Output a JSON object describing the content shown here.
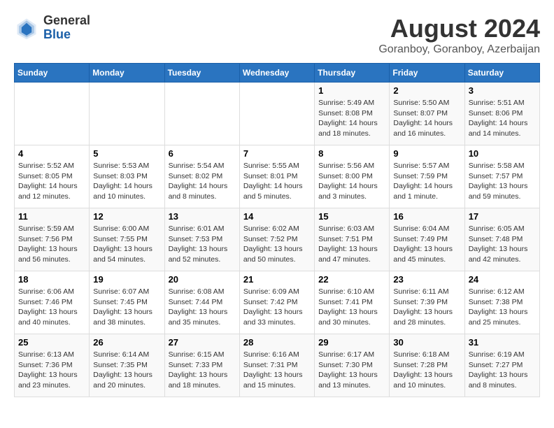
{
  "header": {
    "logo_general": "General",
    "logo_blue": "Blue",
    "month_year": "August 2024",
    "location": "Goranboy, Goranboy, Azerbaijan"
  },
  "weekdays": [
    "Sunday",
    "Monday",
    "Tuesday",
    "Wednesday",
    "Thursday",
    "Friday",
    "Saturday"
  ],
  "weeks": [
    [
      {
        "day": "",
        "info": ""
      },
      {
        "day": "",
        "info": ""
      },
      {
        "day": "",
        "info": ""
      },
      {
        "day": "",
        "info": ""
      },
      {
        "day": "1",
        "info": "Sunrise: 5:49 AM\nSunset: 8:08 PM\nDaylight: 14 hours\nand 18 minutes."
      },
      {
        "day": "2",
        "info": "Sunrise: 5:50 AM\nSunset: 8:07 PM\nDaylight: 14 hours\nand 16 minutes."
      },
      {
        "day": "3",
        "info": "Sunrise: 5:51 AM\nSunset: 8:06 PM\nDaylight: 14 hours\nand 14 minutes."
      }
    ],
    [
      {
        "day": "4",
        "info": "Sunrise: 5:52 AM\nSunset: 8:05 PM\nDaylight: 14 hours\nand 12 minutes."
      },
      {
        "day": "5",
        "info": "Sunrise: 5:53 AM\nSunset: 8:03 PM\nDaylight: 14 hours\nand 10 minutes."
      },
      {
        "day": "6",
        "info": "Sunrise: 5:54 AM\nSunset: 8:02 PM\nDaylight: 14 hours\nand 8 minutes."
      },
      {
        "day": "7",
        "info": "Sunrise: 5:55 AM\nSunset: 8:01 PM\nDaylight: 14 hours\nand 5 minutes."
      },
      {
        "day": "8",
        "info": "Sunrise: 5:56 AM\nSunset: 8:00 PM\nDaylight: 14 hours\nand 3 minutes."
      },
      {
        "day": "9",
        "info": "Sunrise: 5:57 AM\nSunset: 7:59 PM\nDaylight: 14 hours\nand 1 minute."
      },
      {
        "day": "10",
        "info": "Sunrise: 5:58 AM\nSunset: 7:57 PM\nDaylight: 13 hours\nand 59 minutes."
      }
    ],
    [
      {
        "day": "11",
        "info": "Sunrise: 5:59 AM\nSunset: 7:56 PM\nDaylight: 13 hours\nand 56 minutes."
      },
      {
        "day": "12",
        "info": "Sunrise: 6:00 AM\nSunset: 7:55 PM\nDaylight: 13 hours\nand 54 minutes."
      },
      {
        "day": "13",
        "info": "Sunrise: 6:01 AM\nSunset: 7:53 PM\nDaylight: 13 hours\nand 52 minutes."
      },
      {
        "day": "14",
        "info": "Sunrise: 6:02 AM\nSunset: 7:52 PM\nDaylight: 13 hours\nand 50 minutes."
      },
      {
        "day": "15",
        "info": "Sunrise: 6:03 AM\nSunset: 7:51 PM\nDaylight: 13 hours\nand 47 minutes."
      },
      {
        "day": "16",
        "info": "Sunrise: 6:04 AM\nSunset: 7:49 PM\nDaylight: 13 hours\nand 45 minutes."
      },
      {
        "day": "17",
        "info": "Sunrise: 6:05 AM\nSunset: 7:48 PM\nDaylight: 13 hours\nand 42 minutes."
      }
    ],
    [
      {
        "day": "18",
        "info": "Sunrise: 6:06 AM\nSunset: 7:46 PM\nDaylight: 13 hours\nand 40 minutes."
      },
      {
        "day": "19",
        "info": "Sunrise: 6:07 AM\nSunset: 7:45 PM\nDaylight: 13 hours\nand 38 minutes."
      },
      {
        "day": "20",
        "info": "Sunrise: 6:08 AM\nSunset: 7:44 PM\nDaylight: 13 hours\nand 35 minutes."
      },
      {
        "day": "21",
        "info": "Sunrise: 6:09 AM\nSunset: 7:42 PM\nDaylight: 13 hours\nand 33 minutes."
      },
      {
        "day": "22",
        "info": "Sunrise: 6:10 AM\nSunset: 7:41 PM\nDaylight: 13 hours\nand 30 minutes."
      },
      {
        "day": "23",
        "info": "Sunrise: 6:11 AM\nSunset: 7:39 PM\nDaylight: 13 hours\nand 28 minutes."
      },
      {
        "day": "24",
        "info": "Sunrise: 6:12 AM\nSunset: 7:38 PM\nDaylight: 13 hours\nand 25 minutes."
      }
    ],
    [
      {
        "day": "25",
        "info": "Sunrise: 6:13 AM\nSunset: 7:36 PM\nDaylight: 13 hours\nand 23 minutes."
      },
      {
        "day": "26",
        "info": "Sunrise: 6:14 AM\nSunset: 7:35 PM\nDaylight: 13 hours\nand 20 minutes."
      },
      {
        "day": "27",
        "info": "Sunrise: 6:15 AM\nSunset: 7:33 PM\nDaylight: 13 hours\nand 18 minutes."
      },
      {
        "day": "28",
        "info": "Sunrise: 6:16 AM\nSunset: 7:31 PM\nDaylight: 13 hours\nand 15 minutes."
      },
      {
        "day": "29",
        "info": "Sunrise: 6:17 AM\nSunset: 7:30 PM\nDaylight: 13 hours\nand 13 minutes."
      },
      {
        "day": "30",
        "info": "Sunrise: 6:18 AM\nSunset: 7:28 PM\nDaylight: 13 hours\nand 10 minutes."
      },
      {
        "day": "31",
        "info": "Sunrise: 6:19 AM\nSunset: 7:27 PM\nDaylight: 13 hours\nand 8 minutes."
      }
    ]
  ]
}
